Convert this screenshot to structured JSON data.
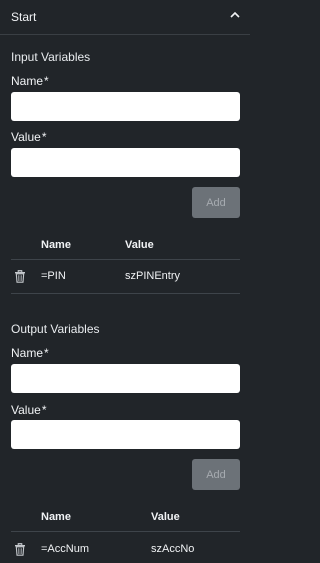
{
  "header": {
    "title": "Start",
    "collapse_icon": "chevron-up-icon"
  },
  "input_section": {
    "title": "Input Variables",
    "name_label": "Name",
    "value_label": "Value",
    "required_marker": "*",
    "name_value": "",
    "value_value": "",
    "add_label": "Add",
    "table": {
      "headers": [
        "Name",
        "Value"
      ],
      "rows": [
        {
          "name": "=PIN",
          "value": "szPINEntry",
          "delete_icon": "trash-icon"
        }
      ]
    }
  },
  "output_section": {
    "title": "Output Variables",
    "name_label": "Name",
    "value_label": "Value",
    "required_marker": "*",
    "name_value": "",
    "value_value": "",
    "add_label": "Add",
    "table": {
      "headers": [
        "Name",
        "Value"
      ],
      "rows": [
        {
          "name": "=AccNum",
          "value": "szAccNo",
          "delete_icon": "trash-icon"
        }
      ]
    }
  }
}
